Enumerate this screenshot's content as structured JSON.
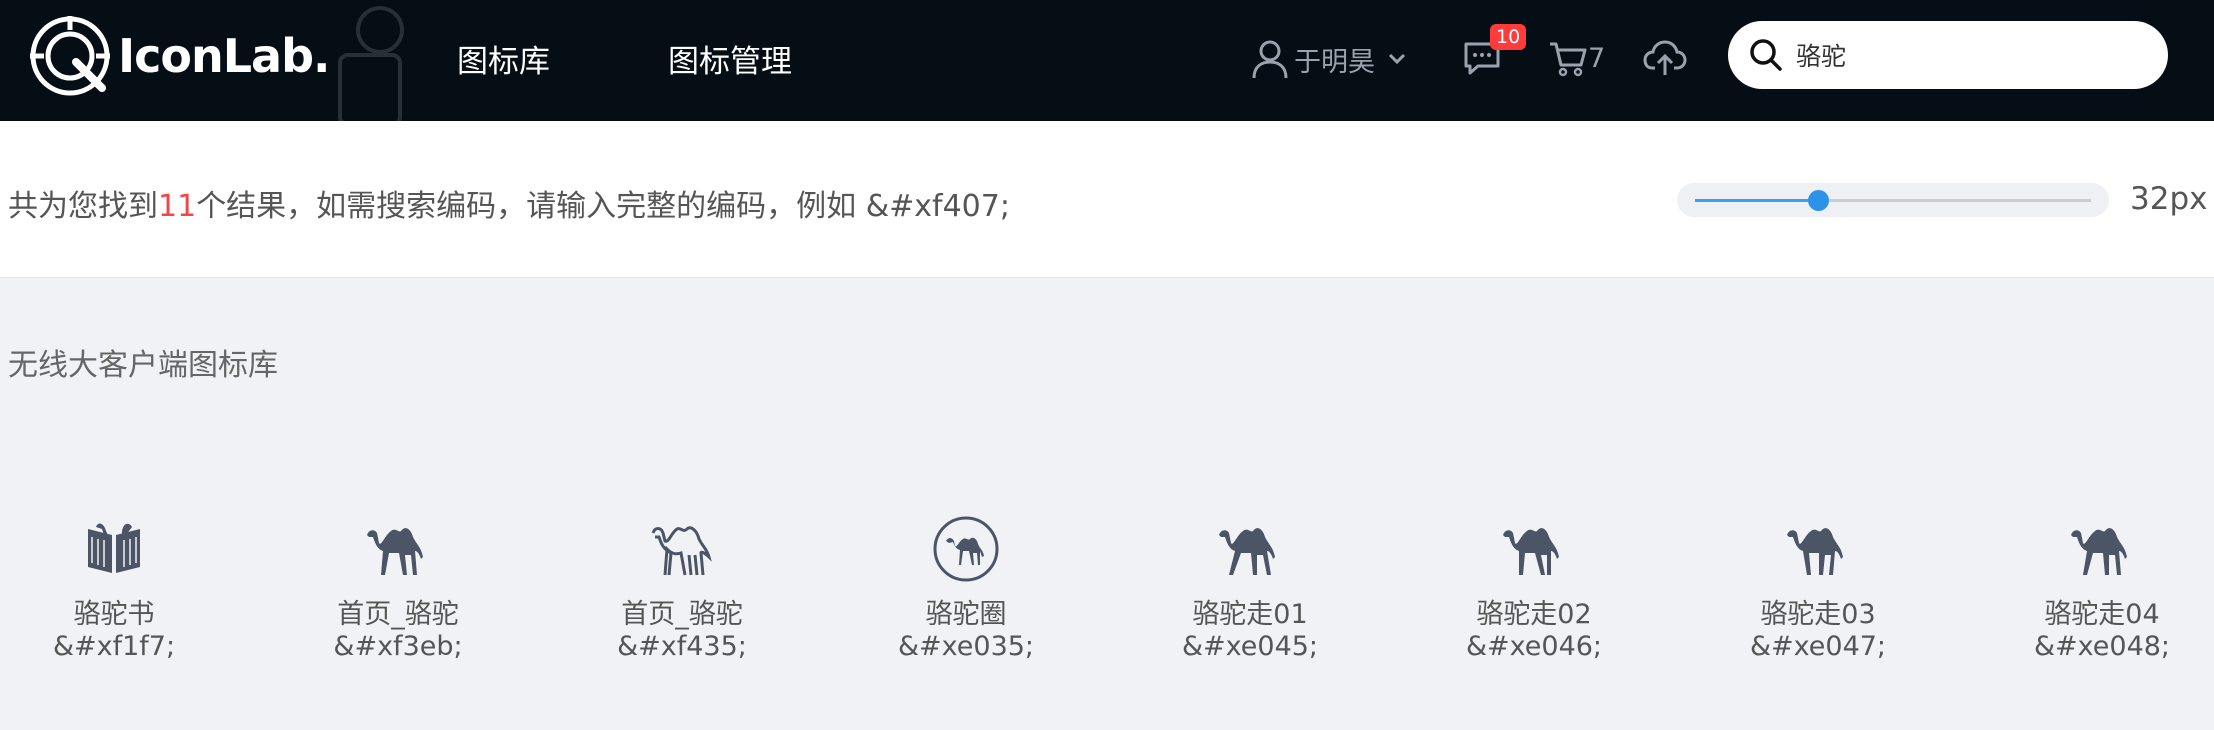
{
  "header": {
    "logo_text": "IconLab.",
    "nav": [
      {
        "label": "图标库"
      },
      {
        "label": "图标管理"
      }
    ],
    "user_name": "于明昊",
    "message_count": "10",
    "cart_count": "7",
    "search_query": "骆驼"
  },
  "result": {
    "prefix": "共为您找到",
    "count": "11",
    "suffix": "个结果，如需搜索编码，请输入完整的编码，例如 &#xf407;",
    "slider_fraction": 0.31,
    "size_label": "32px"
  },
  "library": {
    "title": "无线大客户端图标库",
    "icons": [
      {
        "name": "骆驼书",
        "code": "&#xf1f7;",
        "icon": "camel-book-icon"
      },
      {
        "name": "首页_骆驼",
        "code": "&#xf3eb;",
        "icon": "camel-icon"
      },
      {
        "name": "首页_骆驼",
        "code": "&#xf435;",
        "icon": "camel-outline-icon"
      },
      {
        "name": "骆驼圈",
        "code": "&#xe035;",
        "icon": "camel-circle-icon"
      },
      {
        "name": "骆驼走01",
        "code": "&#xe045;",
        "icon": "camel-walk-icon"
      },
      {
        "name": "骆驼走02",
        "code": "&#xe046;",
        "icon": "camel-walk-icon"
      },
      {
        "name": "骆驼走03",
        "code": "&#xe047;",
        "icon": "camel-walk-icon"
      },
      {
        "name": "骆驼走04",
        "code": "&#xe048;",
        "icon": "camel-walk-icon"
      }
    ]
  },
  "colors": {
    "header_bg": "#050d15",
    "accent_blue": "#2c93e8",
    "count_red": "#f04848",
    "icon_color": "#4c5566"
  }
}
